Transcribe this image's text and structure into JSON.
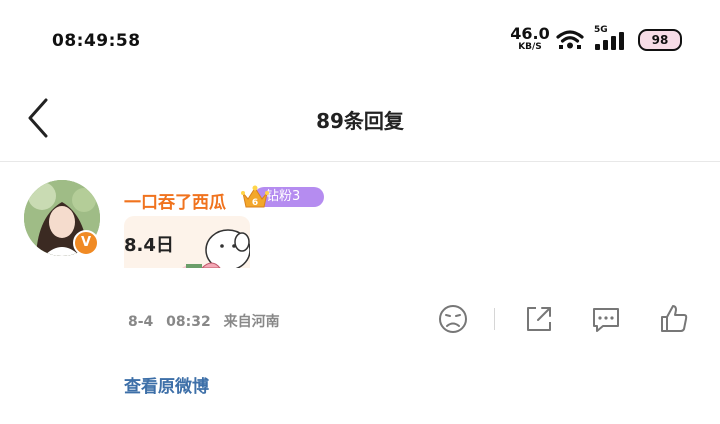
{
  "status_bar": {
    "time": "08:49:58",
    "net_speed": "46.0",
    "net_unit": "KB/S",
    "network_type": "5G",
    "battery": "98"
  },
  "header": {
    "title": "89条回复"
  },
  "comment": {
    "username": "一口吞了西瓜",
    "fan_badge": "钻粉3",
    "fan_level": "6",
    "verified_mark": "V",
    "text": "8.4日",
    "date": "8-4",
    "time": "08:32",
    "location": "来自河南"
  },
  "footer": {
    "view_original": "查看原微博"
  },
  "colors": {
    "username": "#f0731e",
    "fan_badge": "#b58cf0",
    "link": "#3d6fa8",
    "meta": "#888888"
  },
  "icons": [
    "back-icon",
    "wifi-icon",
    "signal-icon",
    "crown-icon",
    "dislike-face-icon",
    "share-icon",
    "comment-icon",
    "like-icon"
  ]
}
